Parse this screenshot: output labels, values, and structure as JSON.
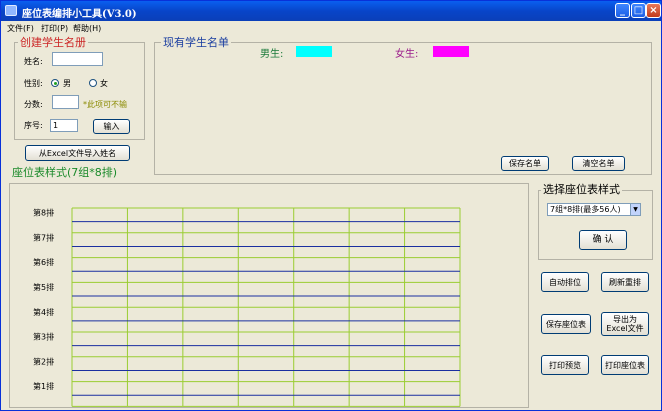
{
  "window": {
    "title": "座位表编排小工具(V3.0)"
  },
  "menu": [
    {
      "label": "文件(F)"
    },
    {
      "label": "打印(P)"
    },
    {
      "label": "帮助(H)"
    }
  ],
  "create": {
    "title": "创建学生名册",
    "name_label": "姓名:",
    "name_value": "",
    "gender_label": "性别:",
    "male_label": "男",
    "female_label": "女",
    "score_label": "分数:",
    "score_value": "",
    "score_hint": "*此项可不输",
    "seq_label": "序号:",
    "seq_value": "1",
    "input_button": "输入"
  },
  "import_button": "从Excel文件导入姓名",
  "existing": {
    "title": "现有学生名单",
    "male_label": "男生:",
    "female_label": "女生:",
    "male_color": "#00ffff",
    "female_color": "#ff00ff",
    "save_button": "保存名单",
    "clear_button": "清空名单"
  },
  "seat_style": {
    "title": "座位表样式(7组*8排)",
    "rows": [
      "第8排",
      "第7排",
      "第6排",
      "第5排",
      "第4排",
      "第3排",
      "第2排",
      "第1排"
    ],
    "grid_color": "#9acd32",
    "row_line_color": "#1a2fa0"
  },
  "choose": {
    "title": "选择座位表样式",
    "selected": "7组*8排(最多56人)",
    "confirm": "确 认"
  },
  "actions": {
    "auto": "自动排位",
    "refresh": "刷新重排",
    "save_table": "保存座位表",
    "export_line1": "导出为",
    "export_line2": "Excel文件",
    "preview": "打印预览",
    "print": "打印座位表"
  }
}
